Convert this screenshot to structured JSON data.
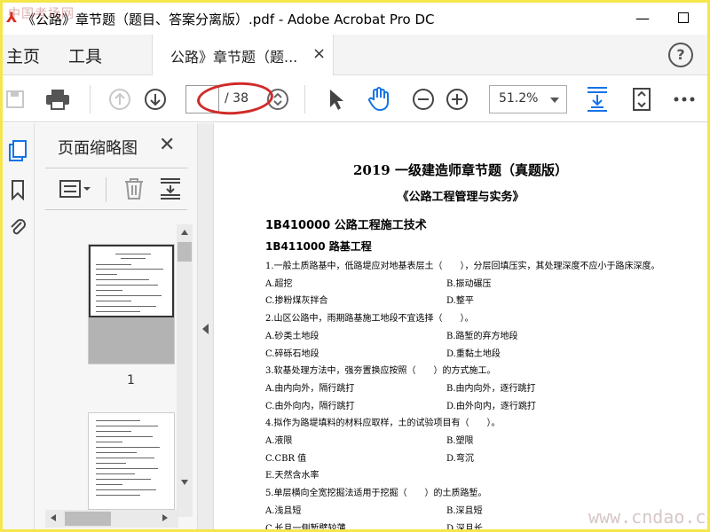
{
  "window": {
    "title": "《公路》章节题（题目、答案分离版）.pdf - Adobe Acrobat Pro DC",
    "watermark": "中国考场网"
  },
  "tabs": {
    "home": "主页",
    "tools": "工具",
    "document": "公路》章节题（题...",
    "close": "×"
  },
  "toolbar": {
    "page_current": "",
    "page_total": "/ 38",
    "zoom": "51.2%"
  },
  "panel": {
    "title": "页面缩略图",
    "close": "✕",
    "thumbnail_page": "1"
  },
  "document": {
    "title": "2019 一级建造师章节题（真题版）",
    "subtitle": "《公路工程管理与实务》",
    "section": "1B410000 公路工程施工技术",
    "subsection": "1B411000 路基工程",
    "lines": [
      {
        "l": "1.一般土质路基中，低路堤应对地基表层土（　　），分层回填压实，其处理深度不应小于路床深度。",
        "r": ""
      },
      {
        "l": "A.超挖",
        "r": "B.振动碾压"
      },
      {
        "l": "C.掺粉煤灰拌合",
        "r": "D.整平"
      },
      {
        "l": "2.山区公路中，雨期路基施工地段不宜选择（　　）。",
        "r": ""
      },
      {
        "l": "A.砂类土地段",
        "r": "B.路堑的弃方地段"
      },
      {
        "l": "C.碎砾石地段",
        "r": "D.重黏土地段"
      },
      {
        "l": "3.软基处理方法中，强夯置换应按照（　　）的方式施工。",
        "r": ""
      },
      {
        "l": "A.由内向外，隔行跳打",
        "r": "B.由内向外，逐行跳打"
      },
      {
        "l": "C.由外向内，隔行跳打",
        "r": "D.由外向内，逐行跳打"
      },
      {
        "l": "4.拟作为路堤填料的材料应取样，土的试验项目有（　　）。",
        "r": ""
      },
      {
        "l": "A.液限",
        "r": "B.塑限"
      },
      {
        "l": "C.CBR 值",
        "r": "D.弯沉"
      },
      {
        "l": "E.天然含水率",
        "r": ""
      },
      {
        "l": "5.单层横向全宽挖掘法适用于挖掘（　　）的土质路堑。",
        "r": ""
      },
      {
        "l": "A.浅且短",
        "r": "B.深且短"
      },
      {
        "l": "C.长且一侧堑壁较薄",
        "r": "D.深且长"
      }
    ],
    "site_watermark": "www.cndao.com"
  }
}
